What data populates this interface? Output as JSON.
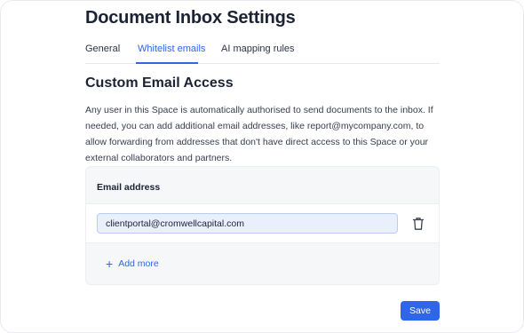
{
  "page": {
    "title": "Document Inbox Settings"
  },
  "tabs": [
    {
      "label": "General",
      "active": false
    },
    {
      "label": "Whitelist emails",
      "active": true
    },
    {
      "label": "AI mapping rules",
      "active": false
    }
  ],
  "section": {
    "title": "Custom Email Access",
    "description": "Any user in this Space is automatically authorised to send documents to the inbox. If needed, you can add additional email addresses, like report@mycompany.com, to allow forwarding from addresses that don't have direct access to this Space or your external collaborators and partners."
  },
  "email_table": {
    "header": "Email address",
    "rows": [
      {
        "value": "clientportal@cromwellcapital.com",
        "delete_icon": "trash-icon"
      }
    ],
    "add_more_label": "Add more",
    "add_icon": "plus-icon"
  },
  "actions": {
    "save_label": "Save"
  },
  "colors": {
    "accent": "#2f65e8",
    "input_bg": "#e9f0fb",
    "panel_bg": "#f6f7f9"
  }
}
